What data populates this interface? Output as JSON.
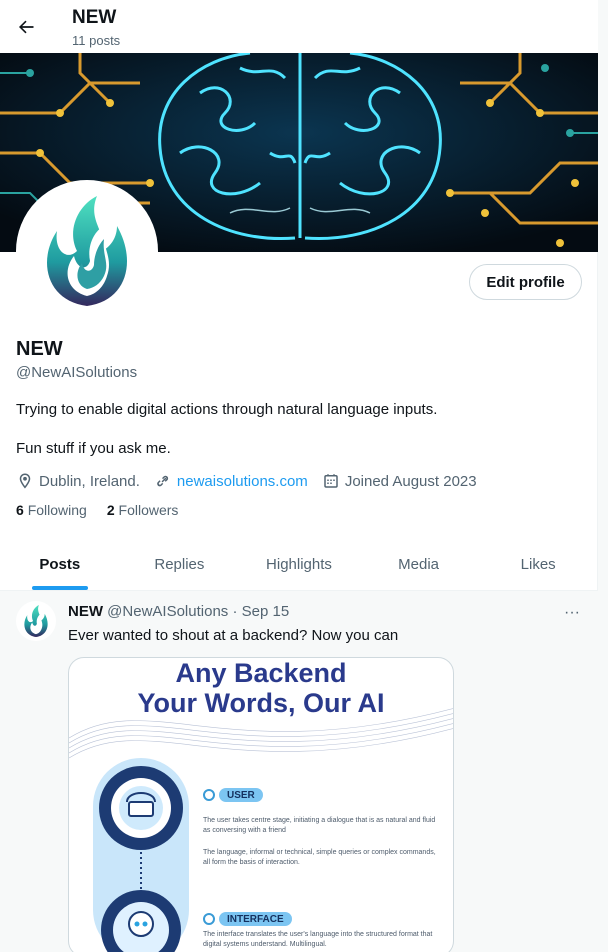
{
  "header": {
    "title": "NEW",
    "post_count": "11 posts"
  },
  "profile": {
    "name": "NEW",
    "handle": "@NewAISolutions",
    "edit_label": "Edit profile",
    "bio_line1": "Trying to enable digital actions through natural language inputs.",
    "bio_line2": "Fun stuff if you ask me.",
    "location": "Dublin, Ireland.",
    "website": "newaisolutions.com",
    "joined": "Joined August 2023",
    "following_count": "6",
    "following_label": "Following",
    "followers_count": "2",
    "followers_label": "Followers"
  },
  "tabs": [
    {
      "label": "Posts",
      "active": true
    },
    {
      "label": "Replies",
      "active": false
    },
    {
      "label": "Highlights",
      "active": false
    },
    {
      "label": "Media",
      "active": false
    },
    {
      "label": "Likes",
      "active": false
    }
  ],
  "post": {
    "author": "NEW",
    "handle": "@NewAISolutions",
    "separator": "·",
    "date": "Sep 15",
    "more": "···",
    "text": "Ever wanted to shout at a backend? Now you can",
    "media": {
      "title_line1": "Any Backend",
      "title_line2": "Your Words, Our AI",
      "user_pill": "USER",
      "user_desc1": "The user takes centre stage, initiating a dialogue that is as natural and fluid as conversing with a friend",
      "user_desc2": "The language, informal or technical, simple queries or complex commands, all form the basis of interaction.",
      "interface_pill": "INTERFACE",
      "interface_desc": "The interface translates the user's language into the structured format that digital systems understand. Multilingual."
    }
  },
  "colors": {
    "accent": "#1d9bf0",
    "text": "#0f1419",
    "muted": "#536471",
    "media_title": "#2a3a8c"
  },
  "icons": {
    "back": "arrow-left-icon",
    "location": "location-pin-icon",
    "link": "link-icon",
    "calendar": "calendar-icon",
    "more": "more-dots-icon"
  }
}
